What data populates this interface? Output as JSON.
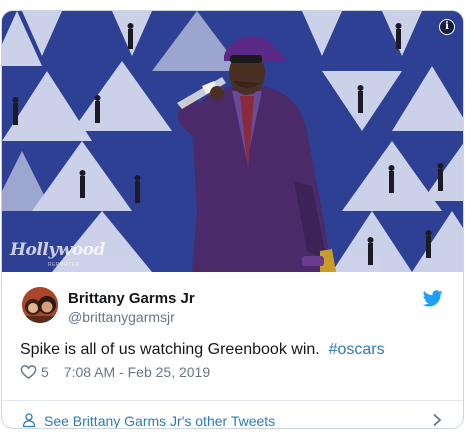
{
  "media": {
    "watermark": "Hollywood",
    "watermark_sub": "REPORTER",
    "info_icon": "i"
  },
  "author": {
    "name": "Brittany Garms Jr",
    "handle": "@brittanygarmsjr"
  },
  "tweet": {
    "text": "Spike is all of us watching Greenbook win.",
    "hashtag": "#oscars",
    "likes": "5",
    "timestamp": "7:08 AM - Feb 25, 2019"
  },
  "footer": {
    "label": "See Brittany Garms Jr's other Tweets"
  },
  "colors": {
    "accent": "#2b7bb9",
    "muted": "#657786",
    "twitter_blue": "#1da1f2",
    "backdrop": "#2b3e8e"
  },
  "icons": [
    "info-icon",
    "twitter-bird-icon",
    "heart-icon",
    "person-icon",
    "chevron-right-icon"
  ]
}
